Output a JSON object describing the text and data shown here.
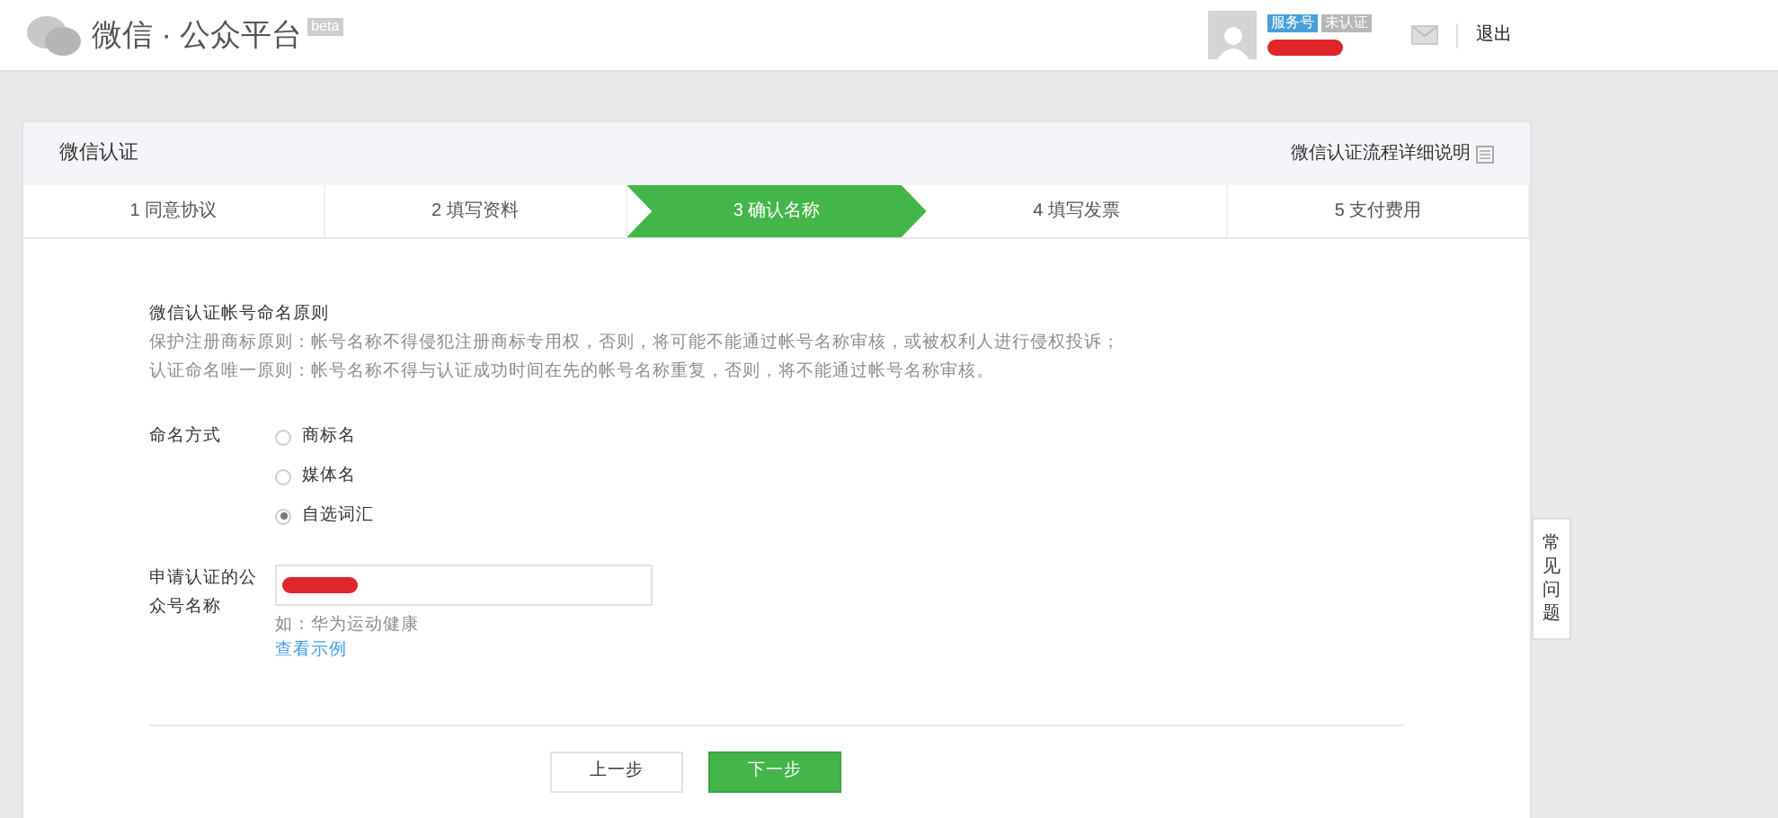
{
  "header": {
    "logo_text": "微信 · 公众平台",
    "beta": "beta",
    "account_badges": [
      {
        "label": "服务号",
        "color": "#4a9fd8"
      },
      {
        "label": "未认证",
        "color": "#b7b7b7"
      }
    ],
    "account_name_redacted": true,
    "logout": "退出"
  },
  "card": {
    "title": "微信认证",
    "help_link": "微信认证流程详细说明"
  },
  "steps": [
    {
      "label": "1 同意协议",
      "selected": false
    },
    {
      "label": "2 填写资料",
      "selected": false
    },
    {
      "label": "3 确认名称",
      "selected": true
    },
    {
      "label": "4 填写发票",
      "selected": false
    },
    {
      "label": "5 支付费用",
      "selected": false
    }
  ],
  "rules": {
    "title": "微信认证帐号命名原则",
    "lines": [
      "保护注册商标原则：帐号名称不得侵犯注册商标专用权，否则，将可能不能通过帐号名称审核，或被权利人进行侵权投诉；",
      "认证命名唯一原则：帐号名称不得与认证成功时间在先的帐号名称重复，否则，将不能通过帐号名称审核。"
    ]
  },
  "naming": {
    "label": "命名方式",
    "options": [
      {
        "label": "商标名",
        "selected": false
      },
      {
        "label": "媒体名",
        "selected": false
      },
      {
        "label": "自选词汇",
        "selected": true
      }
    ]
  },
  "name_field": {
    "label": "申请认证的公众号名称",
    "value_redacted": true,
    "hint": "如：华为运动健康",
    "example_link": "查看示例"
  },
  "buttons": [
    {
      "label": "上一步",
      "kind": "secondary"
    },
    {
      "label": "下一步",
      "kind": "primary"
    }
  ],
  "side_tab": "常见问题"
}
